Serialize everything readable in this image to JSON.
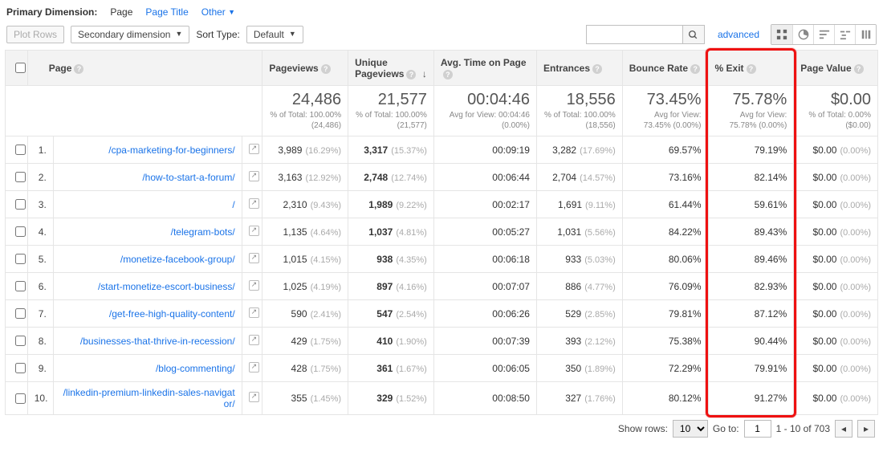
{
  "top": {
    "label": "Primary Dimension:",
    "active": "Page",
    "links": [
      "Page Title",
      "Other"
    ]
  },
  "controls": {
    "plot_rows": "Plot Rows",
    "secondary_dim": "Secondary dimension",
    "sort_type_label": "Sort Type:",
    "sort_type_value": "Default",
    "search_placeholder": "",
    "advanced": "advanced"
  },
  "headers": {
    "page": "Page",
    "pageviews": "Pageviews",
    "unique": "Unique Pageviews",
    "avgtime": "Avg. Time on Page",
    "entrances": "Entrances",
    "bounce": "Bounce Rate",
    "exit": "% Exit",
    "value": "Page Value"
  },
  "totals": {
    "pageviews": {
      "big": "24,486",
      "sub": "% of Total: 100.00% (24,486)"
    },
    "unique": {
      "big": "21,577",
      "sub": "% of Total: 100.00% (21,577)"
    },
    "avgtime": {
      "big": "00:04:46",
      "sub": "Avg for View: 00:04:46 (0.00%)"
    },
    "entrances": {
      "big": "18,556",
      "sub": "% of Total: 100.00% (18,556)"
    },
    "bounce": {
      "big": "73.45%",
      "sub": "Avg for View: 73.45% (0.00%)"
    },
    "exit": {
      "big": "75.78%",
      "sub": "Avg for View: 75.78% (0.00%)"
    },
    "value": {
      "big": "$0.00",
      "sub": "% of Total: 0.00% ($0.00)"
    }
  },
  "rows": [
    {
      "n": "1.",
      "page": "/cpa-marketing-for-beginners/",
      "pv": "3,989",
      "pvp": "(16.29%)",
      "uq": "3,317",
      "uqp": "(15.37%)",
      "t": "00:09:19",
      "en": "3,282",
      "enp": "(17.69%)",
      "b": "69.57%",
      "x": "79.19%",
      "v": "$0.00",
      "vp": "(0.00%)"
    },
    {
      "n": "2.",
      "page": "/how-to-start-a-forum/",
      "pv": "3,163",
      "pvp": "(12.92%)",
      "uq": "2,748",
      "uqp": "(12.74%)",
      "t": "00:06:44",
      "en": "2,704",
      "enp": "(14.57%)",
      "b": "73.16%",
      "x": "82.14%",
      "v": "$0.00",
      "vp": "(0.00%)"
    },
    {
      "n": "3.",
      "page": "/",
      "pv": "2,310",
      "pvp": "(9.43%)",
      "uq": "1,989",
      "uqp": "(9.22%)",
      "t": "00:02:17",
      "en": "1,691",
      "enp": "(9.11%)",
      "b": "61.44%",
      "x": "59.61%",
      "v": "$0.00",
      "vp": "(0.00%)"
    },
    {
      "n": "4.",
      "page": "/telegram-bots/",
      "pv": "1,135",
      "pvp": "(4.64%)",
      "uq": "1,037",
      "uqp": "(4.81%)",
      "t": "00:05:27",
      "en": "1,031",
      "enp": "(5.56%)",
      "b": "84.22%",
      "x": "89.43%",
      "v": "$0.00",
      "vp": "(0.00%)"
    },
    {
      "n": "5.",
      "page": "/monetize-facebook-group/",
      "pv": "1,015",
      "pvp": "(4.15%)",
      "uq": "938",
      "uqp": "(4.35%)",
      "t": "00:06:18",
      "en": "933",
      "enp": "(5.03%)",
      "b": "80.06%",
      "x": "89.46%",
      "v": "$0.00",
      "vp": "(0.00%)"
    },
    {
      "n": "6.",
      "page": "/start-monetize-escort-business/",
      "pv": "1,025",
      "pvp": "(4.19%)",
      "uq": "897",
      "uqp": "(4.16%)",
      "t": "00:07:07",
      "en": "886",
      "enp": "(4.77%)",
      "b": "76.09%",
      "x": "82.93%",
      "v": "$0.00",
      "vp": "(0.00%)"
    },
    {
      "n": "7.",
      "page": "/get-free-high-quality-content/",
      "pv": "590",
      "pvp": "(2.41%)",
      "uq": "547",
      "uqp": "(2.54%)",
      "t": "00:06:26",
      "en": "529",
      "enp": "(2.85%)",
      "b": "79.81%",
      "x": "87.12%",
      "v": "$0.00",
      "vp": "(0.00%)"
    },
    {
      "n": "8.",
      "page": "/businesses-that-thrive-in-recession/",
      "pv": "429",
      "pvp": "(1.75%)",
      "uq": "410",
      "uqp": "(1.90%)",
      "t": "00:07:39",
      "en": "393",
      "enp": "(2.12%)",
      "b": "75.38%",
      "x": "90.44%",
      "v": "$0.00",
      "vp": "(0.00%)"
    },
    {
      "n": "9.",
      "page": "/blog-commenting/",
      "pv": "428",
      "pvp": "(1.75%)",
      "uq": "361",
      "uqp": "(1.67%)",
      "t": "00:06:05",
      "en": "350",
      "enp": "(1.89%)",
      "b": "72.29%",
      "x": "79.91%",
      "v": "$0.00",
      "vp": "(0.00%)"
    },
    {
      "n": "10.",
      "page": "/linkedin-premium-linkedin-sales-navigator/",
      "pv": "355",
      "pvp": "(1.45%)",
      "uq": "329",
      "uqp": "(1.52%)",
      "t": "00:08:50",
      "en": "327",
      "enp": "(1.76%)",
      "b": "80.12%",
      "x": "91.27%",
      "v": "$0.00",
      "vp": "(0.00%)"
    }
  ],
  "pager": {
    "show_rows_label": "Show rows:",
    "show_rows_value": "10",
    "goto_label": "Go to:",
    "goto_value": "1",
    "range": "1 - 10 of 703"
  }
}
